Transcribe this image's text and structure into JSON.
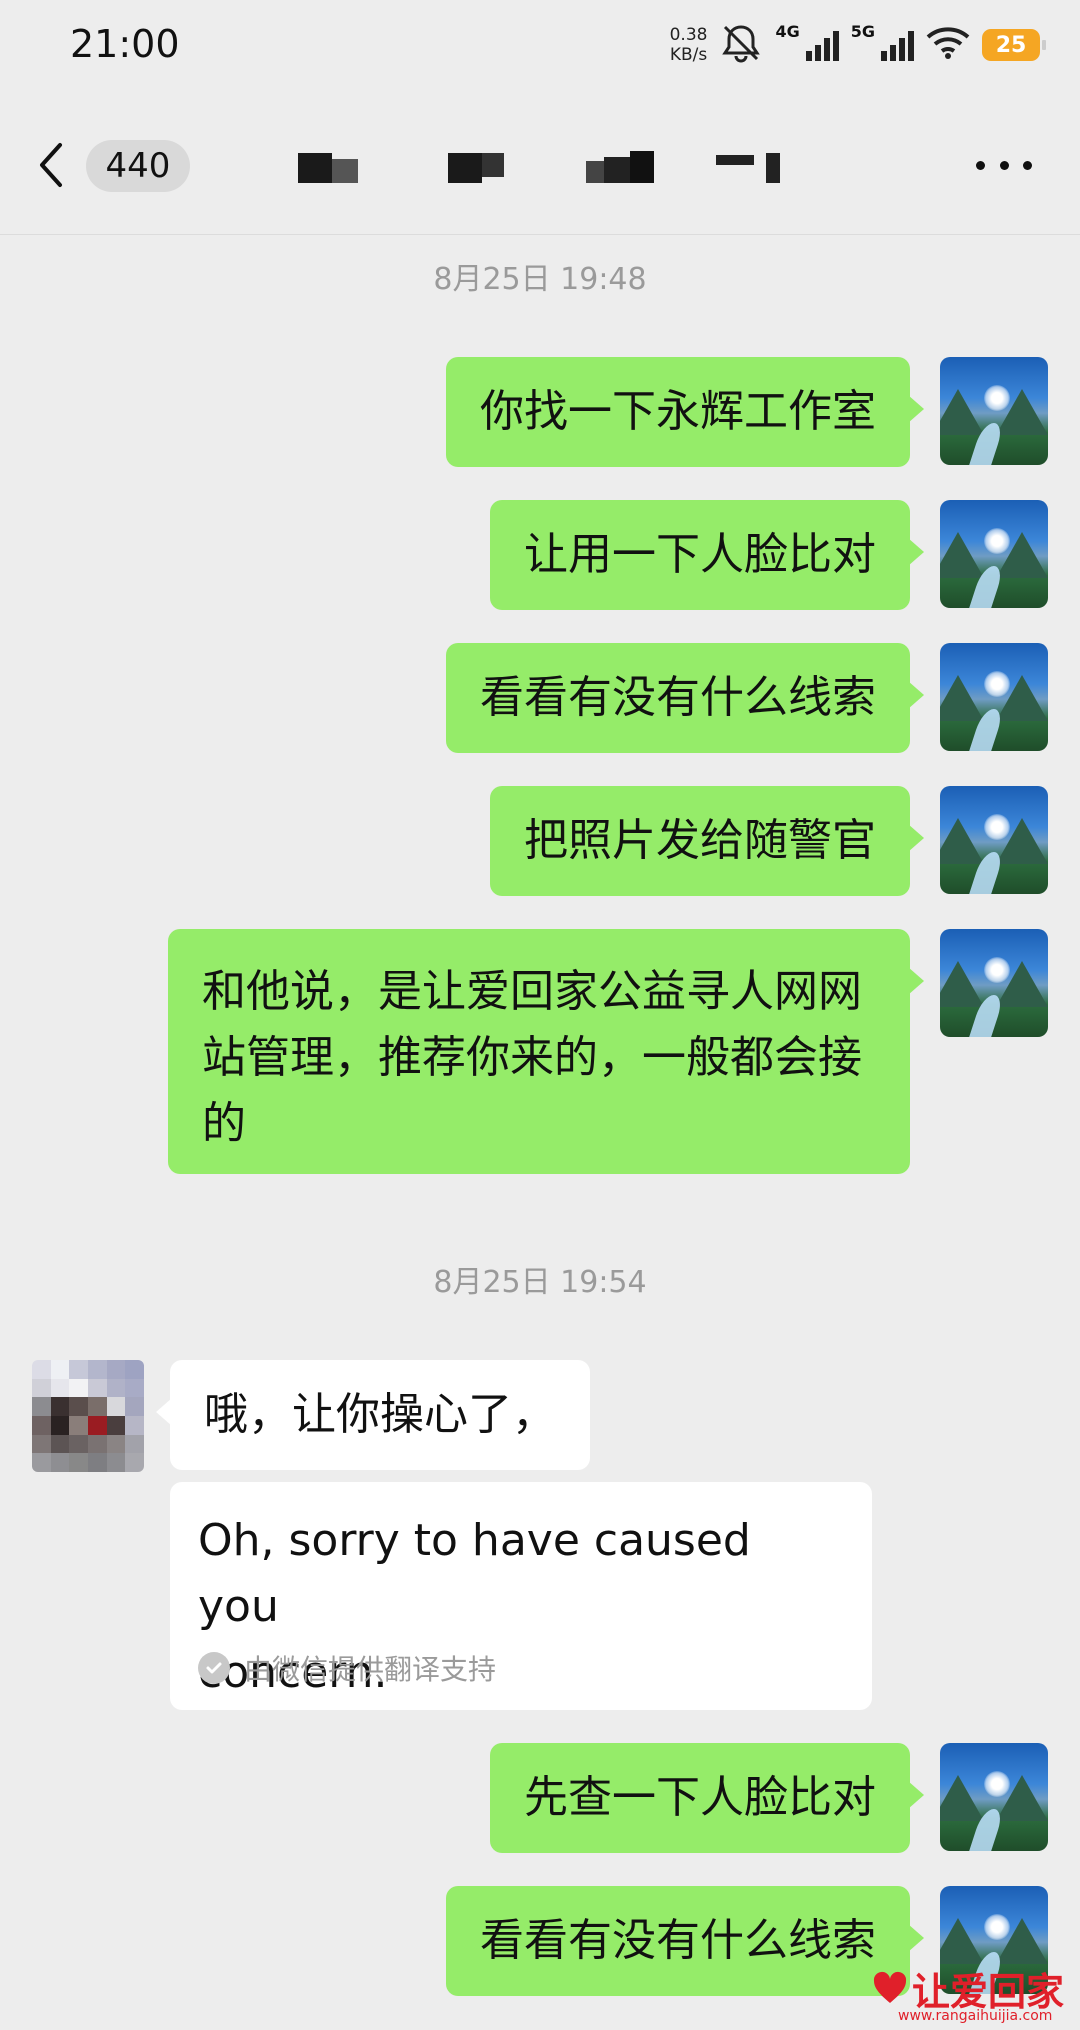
{
  "status_bar": {
    "time": "21:00",
    "net_speed_value": "0.38",
    "net_speed_unit": "KB/s",
    "signal_1": "4G",
    "signal_2": "5G",
    "battery": "25",
    "icons": [
      "mute-icon",
      "signal-4g-icon",
      "signal-5g-icon",
      "wifi-icon",
      "battery-icon"
    ]
  },
  "header": {
    "unread_count": "440",
    "title": "",
    "icons": [
      "back-chevron-icon",
      "more-dots-icon"
    ]
  },
  "timestamps": [
    "8月25日 19:48",
    "8月25日 19:54"
  ],
  "messages_out_1": [
    "你找一下永辉工作室",
    "让用一下人脸比对",
    "看看有没有什么线索",
    "把照片发给随警官"
  ],
  "message_out_long": {
    "line1": "和他说，是让爱回家公益寻人网网",
    "line2": "站管理，推荐你来的，一般都会接",
    "line3": "的"
  },
  "message_in": {
    "text": "哦，让你操心了，",
    "translation_line1": "Oh, sorry to have caused you",
    "translation_line2": "concern.",
    "translation_note": "由微信提供翻译支持"
  },
  "messages_out_2": [
    "先查一下人脸比对",
    "看看有没有什么线索"
  ],
  "watermark": {
    "logo": "让爱回家",
    "url": "www.rangaihuijia.com"
  },
  "colors": {
    "background": "#ededed",
    "outgoing_bubble": "#95ec69",
    "incoming_bubble": "#ffffff",
    "battery": "#f5a623",
    "watermark": "#e0202a"
  }
}
